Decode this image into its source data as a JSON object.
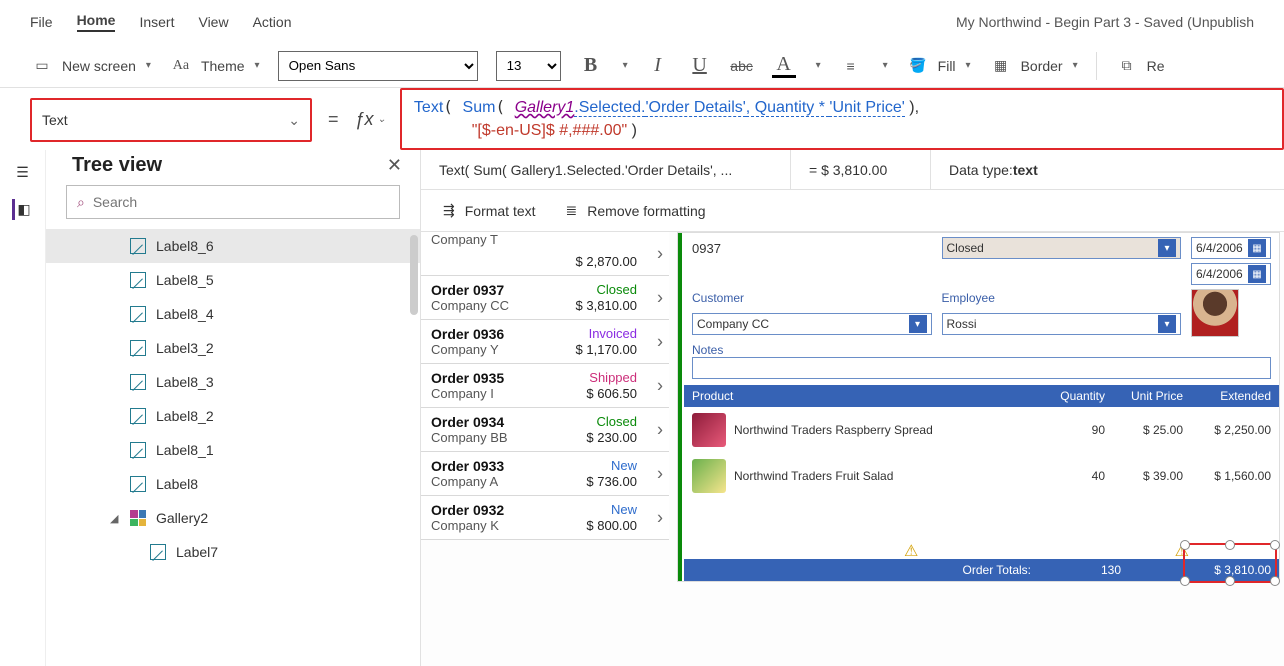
{
  "title": "My Northwind - Begin Part 3 - Saved (Unpublish",
  "menu": {
    "file": "File",
    "home": "Home",
    "insert": "Insert",
    "view": "View",
    "action": "Action"
  },
  "toolbar": {
    "new_screen": "New screen",
    "theme": "Theme",
    "font": "Open Sans",
    "font_size": "13",
    "fill": "Fill",
    "border": "Border",
    "reorder": "Re"
  },
  "prop": {
    "name": "Text"
  },
  "formula": {
    "fn1": "Text",
    "fn2": "Sum",
    "id": "Gallery1",
    "sel": ".Selected.",
    "field1": "'Order Details'",
    "args": ", Quantity * ",
    "field2": "'Unit Price'",
    "close1": " )",
    "comma": ",",
    "str": "\"[$-en-US]$ #,###.00\"",
    "close2": " )"
  },
  "result": {
    "expr_short": "Text( Sum( Gallery1.Selected.'Order Details', ...",
    "eq": "=",
    "value": "$ 3,810.00",
    "datatype_label": "Data type: ",
    "datatype_value": "text"
  },
  "formatbar": {
    "format": "Format text",
    "remove": "Remove formatting"
  },
  "tree": {
    "heading": "Tree view",
    "search_placeholder": "Search",
    "items": [
      "Label8_6",
      "Label8_5",
      "Label8_4",
      "Label3_2",
      "Label8_3",
      "Label8_2",
      "Label8_1",
      "Label8"
    ],
    "gallery": "Gallery2",
    "child": "Label7"
  },
  "orders": [
    {
      "id": "",
      "cust": "Company T",
      "status": "",
      "status_cls": "",
      "amount": "$ 2,870.00"
    },
    {
      "id": "Order 0937",
      "cust": "Company CC",
      "status": "Closed",
      "status_cls": "st-closed",
      "amount": "$ 3,810.00"
    },
    {
      "id": "Order 0936",
      "cust": "Company Y",
      "status": "Invoiced",
      "status_cls": "st-invoiced",
      "amount": "$ 1,170.00"
    },
    {
      "id": "Order 0935",
      "cust": "Company I",
      "status": "Shipped",
      "status_cls": "st-shipped",
      "amount": "$ 606.50"
    },
    {
      "id": "Order 0934",
      "cust": "Company BB",
      "status": "Closed",
      "status_cls": "st-closed",
      "amount": "$ 230.00"
    },
    {
      "id": "Order 0933",
      "cust": "Company A",
      "status": "New",
      "status_cls": "st-new",
      "amount": "$ 736.00"
    },
    {
      "id": "Order 0932",
      "cust": "Company K",
      "status": "New",
      "status_cls": "st-new",
      "amount": "$ 800.00"
    }
  ],
  "form": {
    "order_id": "0937",
    "status": "Closed",
    "date1": "6/4/2006",
    "date2": "6/4/2006",
    "customer_label": "Customer",
    "customer": "Company CC",
    "employee_label": "Employee",
    "employee": "Rossi",
    "notes_label": "Notes",
    "notes": "",
    "head_product": "Product",
    "head_qty": "Quantity",
    "head_price": "Unit Price",
    "head_ext": "Extended",
    "rows": [
      {
        "name": "Northwind Traders Raspberry Spread",
        "qty": "90",
        "price": "$ 25.00",
        "ext": "$ 2,250.00"
      },
      {
        "name": "Northwind Traders Fruit Salad",
        "qty": "40",
        "price": "$ 39.00",
        "ext": "$ 1,560.00"
      }
    ],
    "totals_label": "Order Totals:",
    "totals_qty": "130",
    "totals_ext": "$ 3,810.00"
  }
}
